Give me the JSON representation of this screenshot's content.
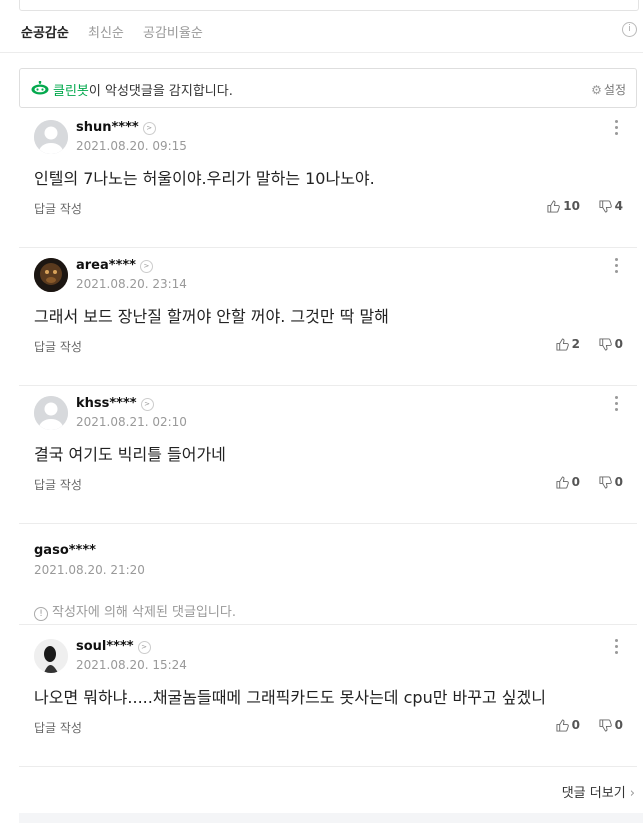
{
  "sort": {
    "tabs": [
      "순공감순",
      "최신순",
      "공감비율순"
    ],
    "info_icon": "info-icon"
  },
  "cleanbot": {
    "name": "클린봇",
    "message": "이 악성댓글을 감지합니다.",
    "settings_label": "설정"
  },
  "comments": [
    {
      "nick": "shun****",
      "date": "2021.08.20. 09:15",
      "text": "인텔의 7나노는 허울이야.우리가 말하는 10나노야.",
      "reply": "답글 작성",
      "likes": "10",
      "dislikes": "4"
    },
    {
      "nick": "area****",
      "date": "2021.08.20. 23:14",
      "text": "그래서 보드 장난질 할꺼야 안할 꺼야. 그것만 딱 말해",
      "reply": "답글 작성",
      "likes": "2",
      "dislikes": "0"
    },
    {
      "nick": "khss****",
      "date": "2021.08.21. 02:10",
      "text": "결국 여기도 빅리틀 들어가네",
      "reply": "답글 작성",
      "likes": "0",
      "dislikes": "0"
    },
    {
      "nick": "gaso****",
      "date": "2021.08.20. 21:20",
      "deleted_text": "작성자에 의해 삭제된 댓글입니다."
    },
    {
      "nick": "soul****",
      "date": "2021.08.20. 15:24",
      "text": "나오면 뭐하냐.....채굴놈들때메 그래픽카드도 못사는데 cpu만 바꾸고 싶겠니",
      "reply": "답글 작성",
      "likes": "0",
      "dislikes": "0"
    }
  ],
  "more_comments_label": "댓글 더보기",
  "colors": {
    "accent_green": "#03a94d"
  }
}
